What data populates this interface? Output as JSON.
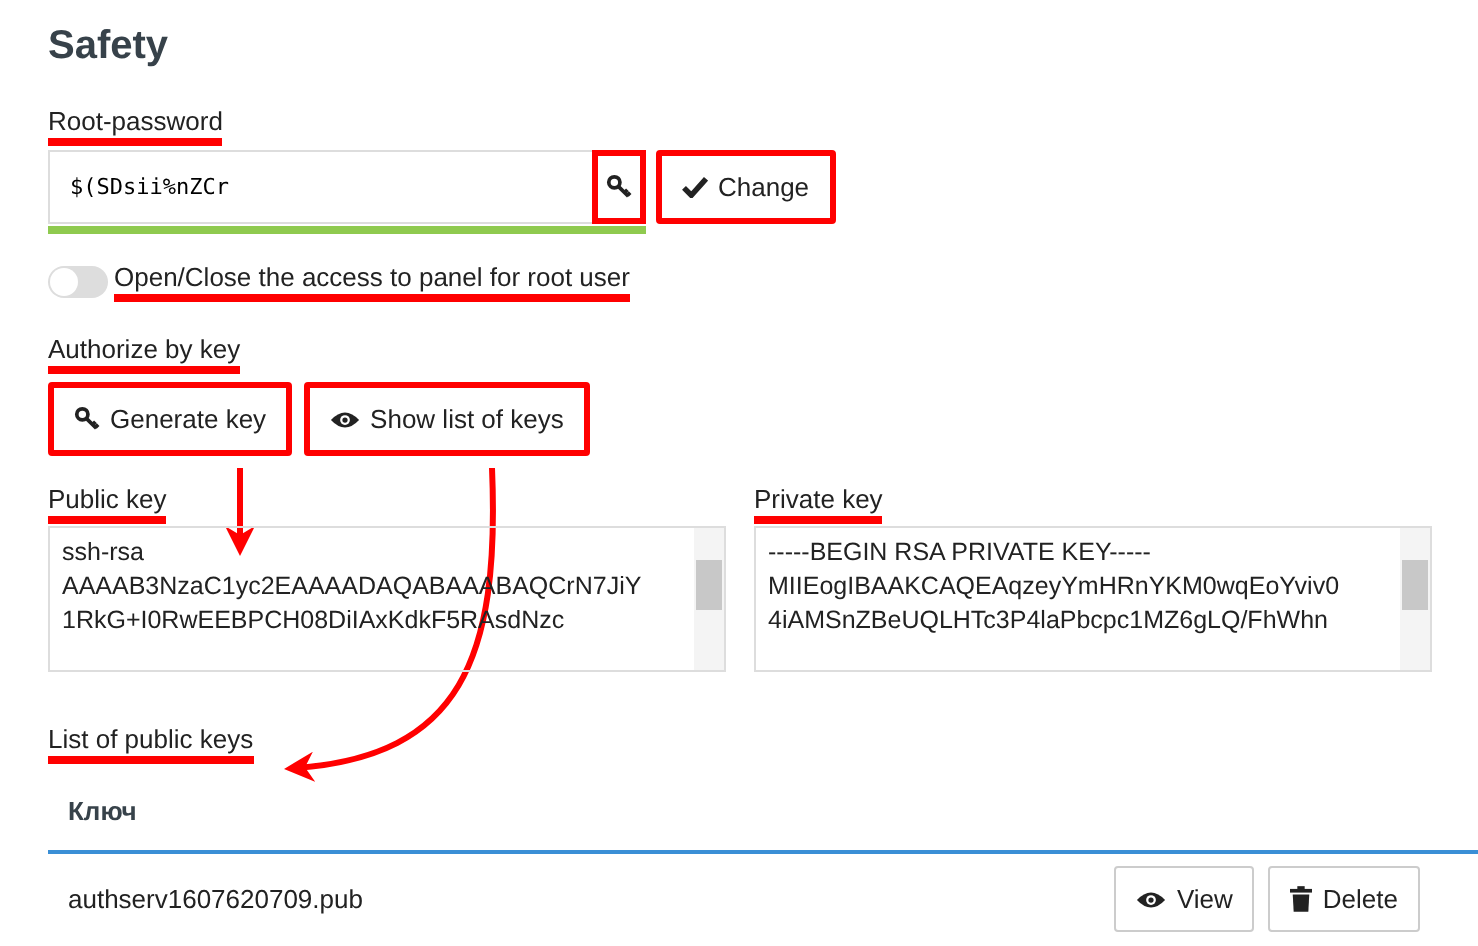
{
  "title": "Safety",
  "root_password": {
    "label": "Root-password",
    "highlighted": true,
    "value": "$(SDsii%nZCr",
    "strength": {
      "level": 1
    }
  },
  "generate_password_button": {
    "highlighted": true
  },
  "change_button": {
    "label": "Change",
    "highlighted": true
  },
  "root_access_toggle": {
    "label": "Open/Close the access to panel for root user",
    "on": false,
    "highlighted": true
  },
  "authorize": {
    "heading": "Authorize by key",
    "highlighted": true,
    "buttons": [
      {
        "kind": "key",
        "label": "Generate key",
        "highlighted": true
      },
      {
        "kind": "eye",
        "label": "Show list of keys",
        "highlighted": true
      }
    ]
  },
  "keys": [
    {
      "label": "Public key",
      "highlighted": true,
      "lines": [
        "ssh-rsa",
        "AAAAB3NzaC1yc2EAAAADAQABAAABAQCrN7JiY",
        "1RkG+I0RwEEBPCH08DiIAxKdkF5RAsdNzc"
      ]
    },
    {
      "label": "Private key",
      "highlighted": true,
      "lines": [
        "-----BEGIN RSA PRIVATE KEY-----",
        "MIIEogIBAAKCAQEAqzeyYmHRnYKM0wqEoYviv0",
        "4iAMSnZBeUQLHTc3P4laPbcpc1MZ6gLQ/FhWhn"
      ]
    }
  ],
  "public_keys": {
    "heading": "List of public keys",
    "highlighted": true,
    "columns": [
      "Ключ"
    ],
    "rows": [
      {
        "cells": [
          "authserv1607620709.pub"
        ],
        "actions": [
          {
            "kind": "eye",
            "label": "View",
            "highlighted": false
          },
          {
            "kind": "trash",
            "label": "Delete",
            "highlighted": false
          }
        ]
      }
    ]
  }
}
